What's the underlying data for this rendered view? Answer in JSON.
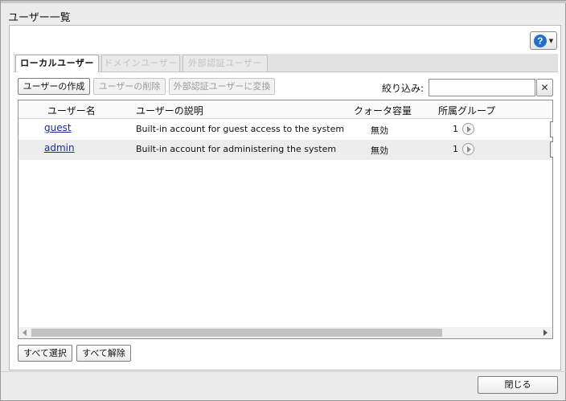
{
  "dialog": {
    "title": "ユーザー一覧",
    "close_label": "閉じる"
  },
  "tabs": [
    {
      "label": "ローカルユーザー",
      "active": true
    },
    {
      "label": "ドメインユーザー",
      "active": false
    },
    {
      "label": "外部認証ユーザー",
      "active": false
    }
  ],
  "toolbar": {
    "create_label": "ユーザーの作成",
    "delete_label": "ユーザーの削除",
    "convert_label": "外部認証ユーザーに変換",
    "filter_label": "絞り込み:",
    "filter_value": "",
    "clear_label": "✕"
  },
  "grid": {
    "columns": [
      "ユーザー名",
      "ユーザーの説明",
      "クォータ容量",
      "所属グループ"
    ],
    "rows": [
      {
        "name": "guest",
        "description": "Built-in account for guest access to the system",
        "quota": "無効",
        "groups": "1"
      },
      {
        "name": "admin",
        "description": "Built-in account for administering the system",
        "quota": "無効",
        "groups": "1"
      }
    ]
  },
  "footer": {
    "select_all_label": "すべて選択",
    "deselect_all_label": "すべて解除"
  },
  "icons": {
    "help": "question-circle-icon",
    "clear": "close-icon",
    "group": "play-icon"
  },
  "colors": {
    "help_blue": "#1f6fc4",
    "link": "#1a2c9c",
    "row_alt": "#ededed"
  }
}
